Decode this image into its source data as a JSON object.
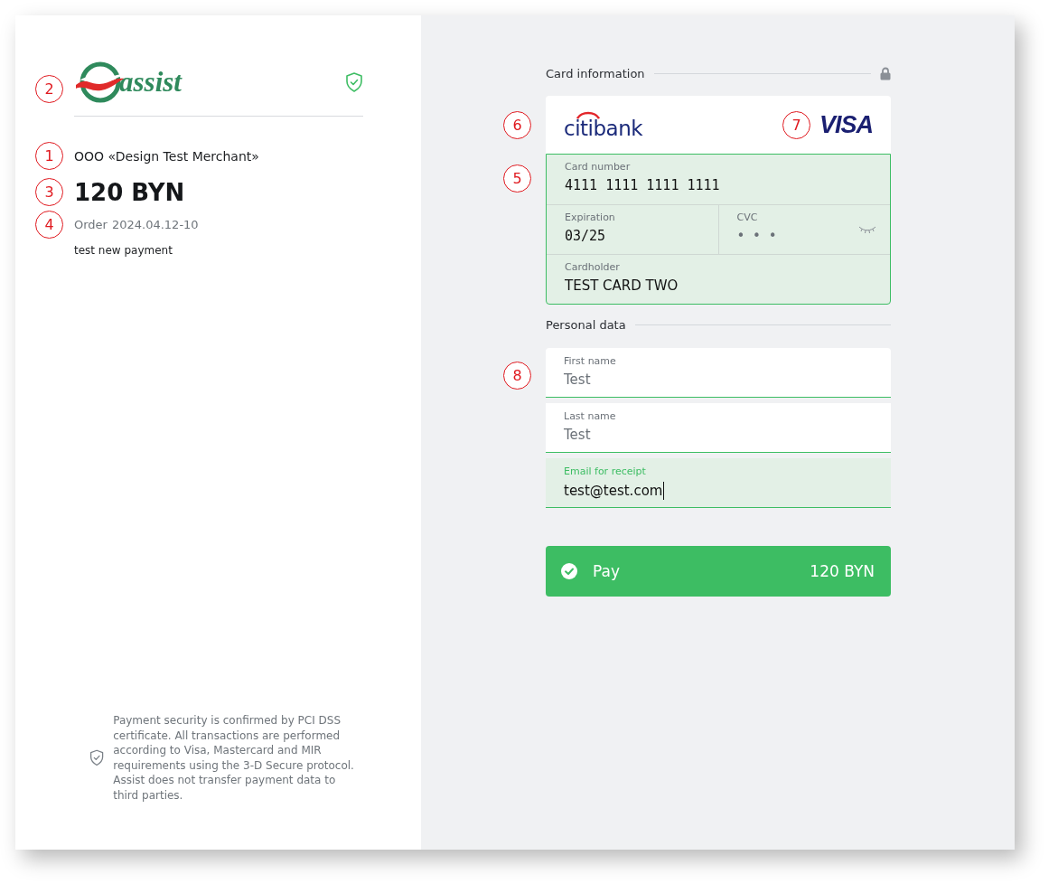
{
  "merchant_panel": {
    "logo": {
      "text": "assist",
      "callout": "2"
    },
    "merchant": {
      "text": "OOO «Design Test Merchant»",
      "callout": "1"
    },
    "amount": {
      "text": "120 BYN",
      "callout": "3"
    },
    "order": {
      "label": "Order",
      "number": "2024.04.12-10",
      "callout": "4"
    },
    "description": "test new payment",
    "security_note": "Payment security is confirmed by PCI DSS certificate. All transactions are performed according to Visa, Mastercard and MIR requirements using the 3-D Secure protocol. Assist does not transfer payment data to third parties."
  },
  "card_section": {
    "title": "Card information",
    "bank": {
      "name": "citibank",
      "callout": "6"
    },
    "network": {
      "name": "VISA",
      "callout": "7"
    },
    "fields_callout": "5",
    "valid": true,
    "card_number": {
      "label": "Card number",
      "value": "4111 1111 1111 1111"
    },
    "expiration": {
      "label": "Expiration",
      "value": "03/25"
    },
    "cvc": {
      "label": "CVC",
      "value": "• • •"
    },
    "cardholder": {
      "label": "Cardholder",
      "value": "TEST CARD TWO"
    }
  },
  "personal_section": {
    "title": "Personal data",
    "callout": "8",
    "fields": [
      {
        "label": "First name",
        "value": "Test",
        "focused": false
      },
      {
        "label": "Last name",
        "value": "Test",
        "focused": false
      },
      {
        "label": "Email for receipt",
        "value": "test@test.com",
        "focused": true
      }
    ]
  },
  "pay_button": {
    "label": "Pay",
    "amount": "120 BYN"
  }
}
